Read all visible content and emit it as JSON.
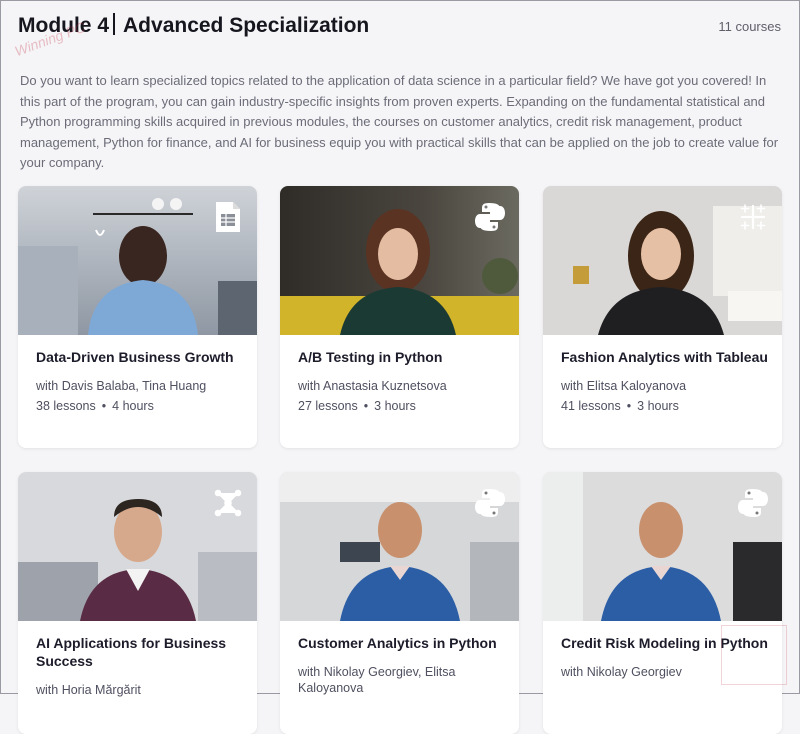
{
  "header": {
    "module": "Module 4",
    "title": "Advanced Specialization",
    "count": "11 courses"
  },
  "description": "Do you want to learn specialized topics related to the application of data science in a particular field? We have got you covered! In this part of the program, you can gain industry-specific insights from proven experts. Expanding on the fundamental statistical and Python programming skills acquired in previous modules, the courses on customer analytics, credit risk management, product management, Python for finance, and AI for business equip you with practical skills that can be applied on the job to create value for your company.",
  "courses": [
    {
      "title": "Data-Driven Business Growth",
      "author": "with Davis Balaba, Tina Huang",
      "lessons": "38 lessons",
      "hours": "4 hours",
      "icon": "spreadsheet-icon"
    },
    {
      "title": "A/B Testing in Python",
      "author": "with Anastasia Kuznetsova",
      "lessons": "27 lessons",
      "hours": "3 hours",
      "icon": "python-icon"
    },
    {
      "title": "Fashion Analytics with Tableau",
      "author": "with Elitsa Kaloyanova",
      "lessons": "41 lessons",
      "hours": "3 hours",
      "icon": "tableau-icon"
    },
    {
      "title": "AI Applications for Business Success",
      "author": "with Horia Mărgărit",
      "lessons": "",
      "hours": "",
      "icon": "network-icon"
    },
    {
      "title": "Customer Analytics in Python",
      "author": "with Nikolay Georgiev, Elitsa Kaloyanova",
      "lessons": "",
      "hours": "",
      "icon": "python-icon"
    },
    {
      "title": "Credit Risk Modeling in Python",
      "author": "with Nikolay Georgiev",
      "lessons": "",
      "hours": "",
      "icon": "python-icon"
    }
  ],
  "watermark": "Winning PC",
  "colors": {
    "background": "#f5f5f7",
    "card": "#ffffff",
    "title": "#16161f",
    "muted": "#6b6c78"
  }
}
